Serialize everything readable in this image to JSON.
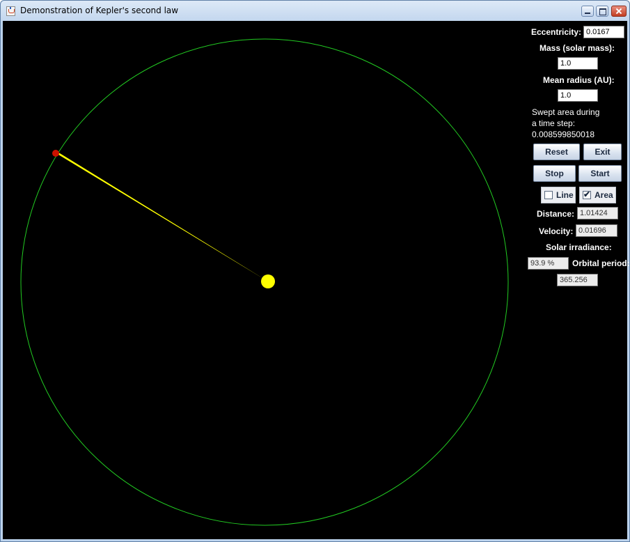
{
  "window": {
    "title": "Demonstration of Kepler's second law"
  },
  "panel": {
    "eccentricity_label": "Eccentricity:",
    "eccentricity_value": "0.0167",
    "mass_label": "Mass (solar mass):",
    "mass_value": "1.0",
    "radius_label": "Mean radius (AU):",
    "radius_value": "1.0",
    "swept_line1": "Swept area during",
    "swept_line2": "a time step:",
    "swept_value": "0.008599850018",
    "reset_label": "Reset",
    "exit_label": "Exit",
    "stop_label": "Stop",
    "start_label": "Start",
    "line_label": "Line",
    "line_checked": false,
    "area_label": "Area",
    "area_checked": true,
    "distance_label": "Distance:",
    "distance_value": "1.01424",
    "velocity_label": "Velocity:",
    "velocity_value": "0.01696",
    "irradiance_label": "Solar irradiance:",
    "irradiance_value": "93.9 %",
    "period_label": "Orbital period:",
    "period_value": "365.256"
  },
  "scene": {
    "background_color": "#000000",
    "orbit_color": "#22cc22",
    "sun_color": "#ffff00",
    "planet_color": "#cc1100",
    "swept_color": "#ffff00"
  }
}
